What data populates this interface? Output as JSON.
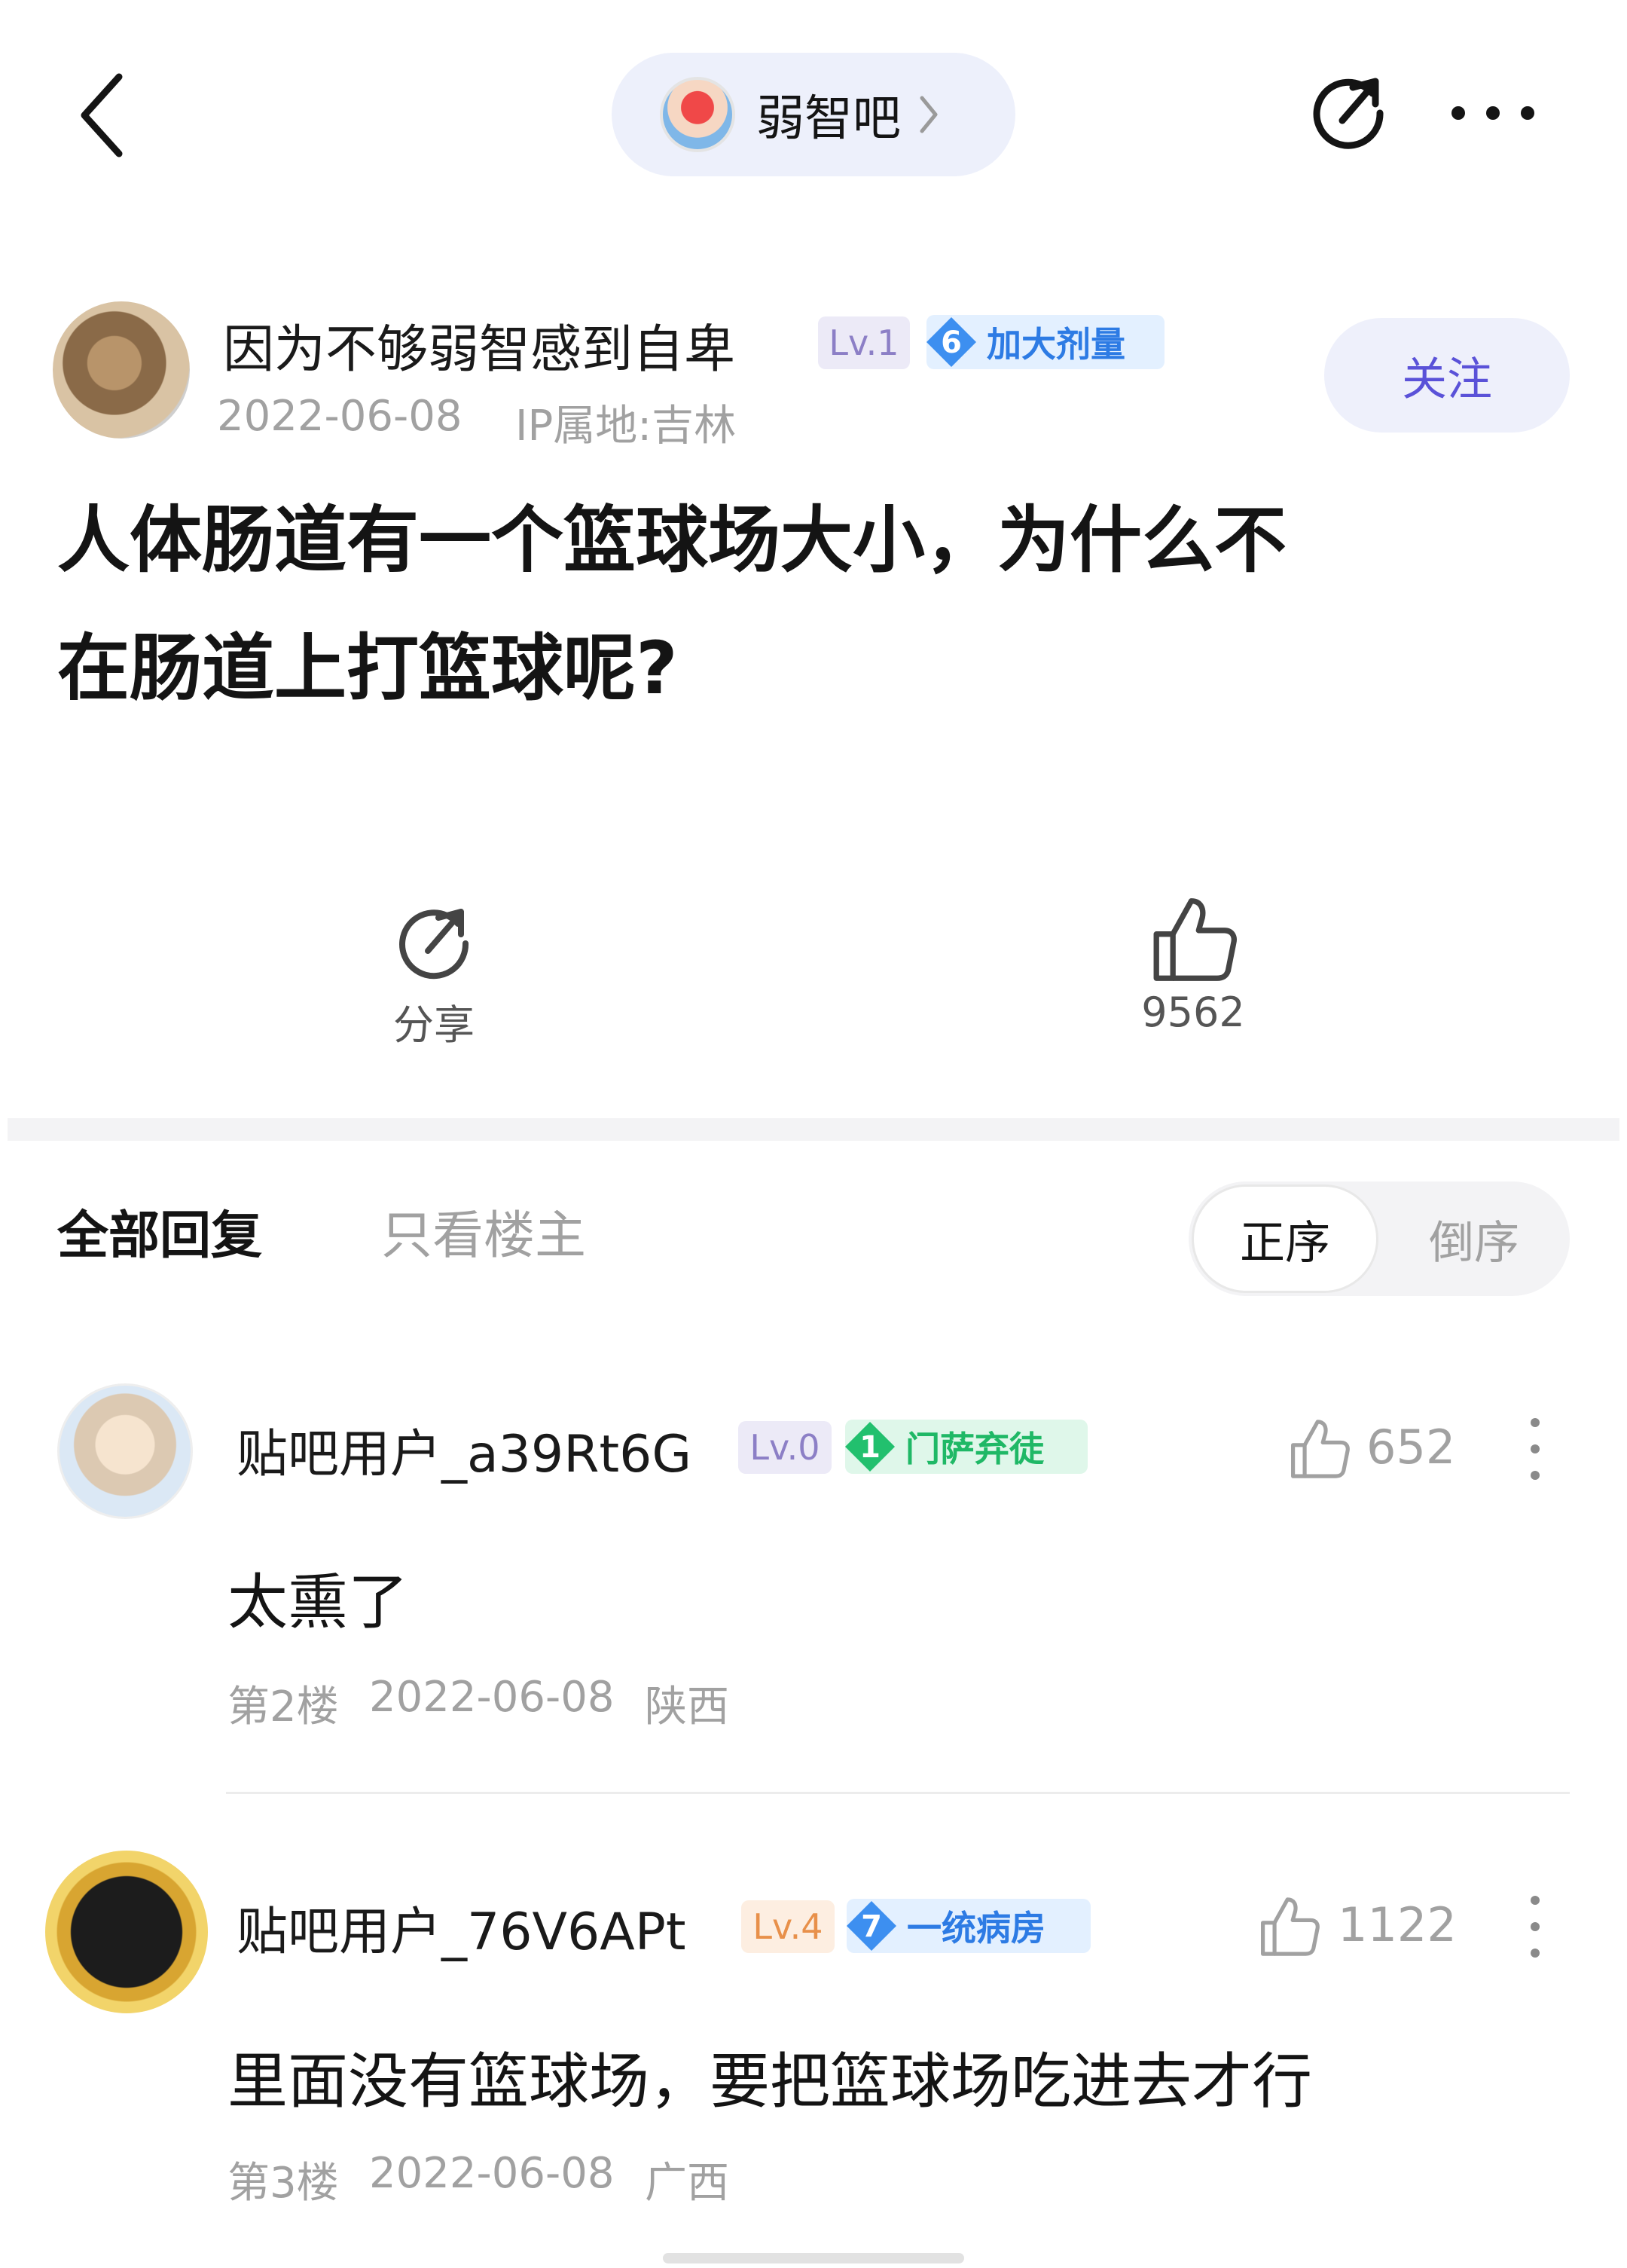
{
  "topbar": {
    "forum_name": "弱智吧",
    "icons": [
      "back-icon",
      "chevron-right-icon",
      "share-icon",
      "more-icon"
    ]
  },
  "post": {
    "author": {
      "name": "因为不够弱智感到自卑",
      "level": "Lv.1",
      "badge_level": "6",
      "badge_title": "加大剂量"
    },
    "date": "2022-06-08",
    "ip": "IP属地:吉林",
    "follow_label": "关注",
    "title_line1": "人体肠道有一个篮球场大小，为什么不",
    "title_line2": "在肠道上打篮球呢?",
    "share_label": "分享",
    "like_count": "9562"
  },
  "tabs": {
    "all": "全部回复",
    "owner_only": "只看楼主",
    "sort_asc": "正序",
    "sort_desc": "倒序"
  },
  "replies": [
    {
      "username": "贴吧用户_a39Rt6G",
      "level": "Lv.0",
      "badge_level": "1",
      "badge_title": "门萨弃徒",
      "likes": "652",
      "content": "太熏了",
      "floor": "第2楼",
      "date": "2022-06-08",
      "location": "陕西"
    },
    {
      "username": "贴吧用户_76V6APt",
      "level": "Lv.4",
      "badge_level": "7",
      "badge_title": "一统病房",
      "likes": "1122",
      "content": "里面没有篮球场，要把篮球场吃进去才行",
      "floor": "第3楼",
      "date": "2022-06-08",
      "location": "广西"
    }
  ],
  "colors": {
    "accent": "#5a52d8",
    "badge_blue": "#2d7be4",
    "badge_green": "#1fb866",
    "muted_text": "#a1a1a1"
  }
}
